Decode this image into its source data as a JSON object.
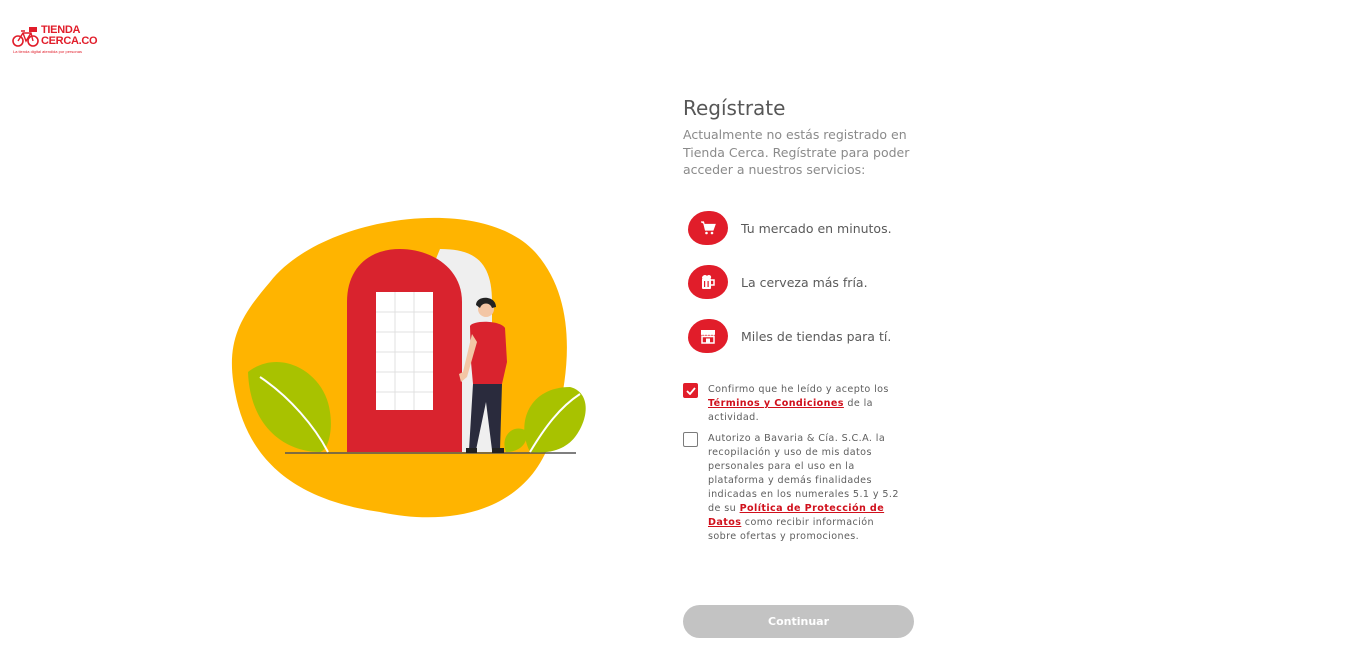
{
  "brand": {
    "line1": "TIENDA",
    "line2": "CERCA.CO",
    "tagline": "La tienda digital atendida por personas",
    "accent_color": "#e11d2a"
  },
  "register": {
    "title": "Regístrate",
    "subtitle": "Actualmente no estás registrado en Tienda Cerca. Regístrate para poder acceder a nuestros servicios:"
  },
  "features": [
    {
      "icon": "cart-icon",
      "label": "Tu mercado en minutos."
    },
    {
      "icon": "beer-mug-icon",
      "label": "La cerveza más fría."
    },
    {
      "icon": "store-icon",
      "label": "Miles de tiendas para tí."
    }
  ],
  "consents": {
    "terms": {
      "checked": true,
      "before": "Confirmo que he leído y acepto los ",
      "link": "Términos y Condiciones",
      "after": " de la actividad."
    },
    "data": {
      "checked": false,
      "before": "Autorizo a Bavaria & Cía. S.C.A. la recopilación y uso de mis datos personales para el uso en la plataforma y demás finalidades indicadas en los numerales 5.1 y 5.2 de su ",
      "link": "Política de Protección de Datos",
      "after": " como recibir información sobre ofertas y promociones."
    }
  },
  "continue_button": {
    "label": "Continuar",
    "disabled_color": "#c3c3c3"
  },
  "illustration": {
    "blob_color": "#ffb400",
    "door_color": "#d9232e",
    "leaf_color": "#a8c200"
  }
}
